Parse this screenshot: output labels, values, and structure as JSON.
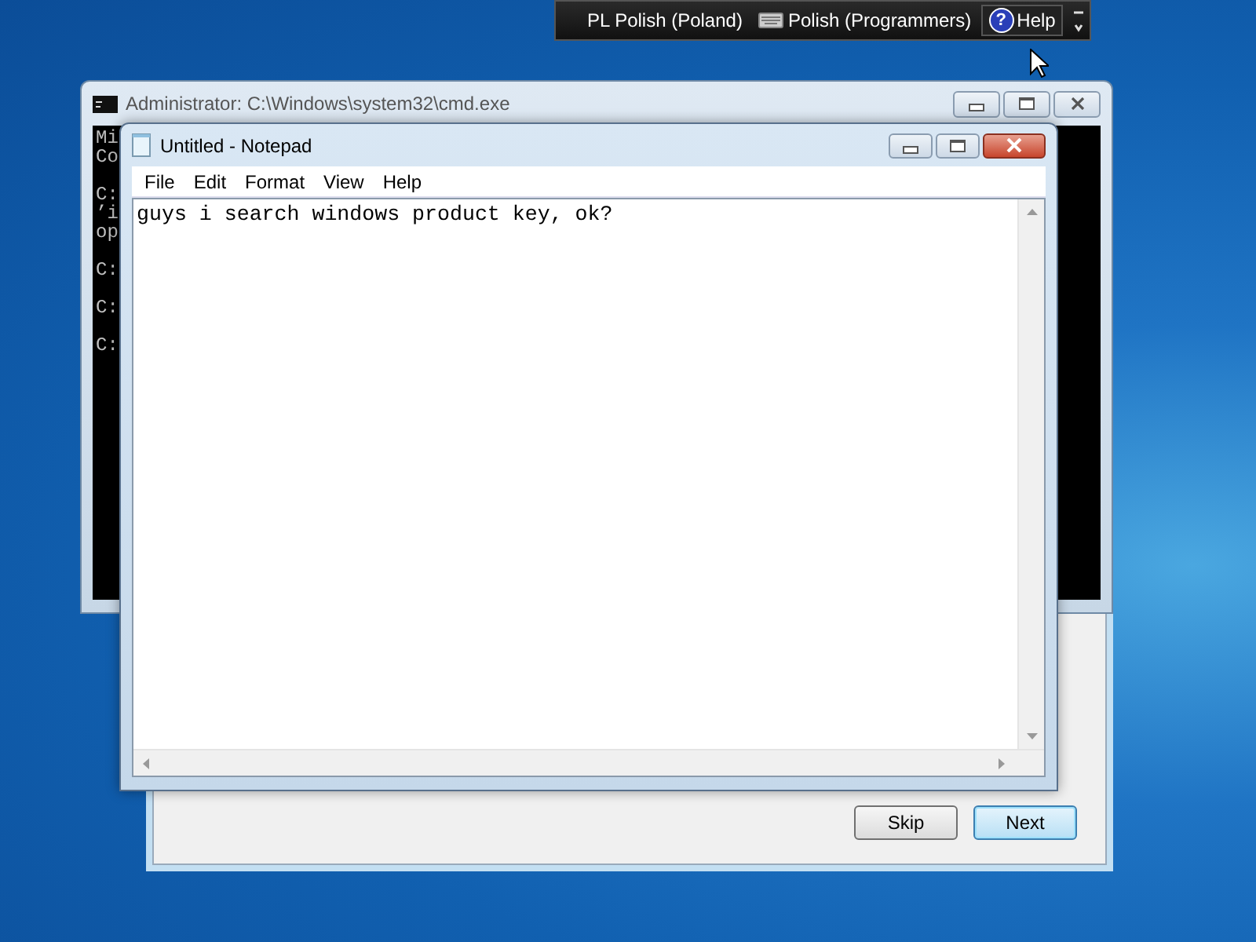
{
  "language_bar": {
    "language": "PL Polish (Poland)",
    "keyboard": "Polish (Programmers)",
    "help_icon": "?",
    "help": "Help"
  },
  "cmd_window": {
    "title": "Administrator: C:\\Windows\\system32\\cmd.exe",
    "blocks": [
      [
        "Mi",
        "Co"
      ],
      [
        "C:",
        "’i",
        "op"
      ],
      [
        "C:"
      ],
      [
        "C:"
      ],
      [
        "C:"
      ]
    ]
  },
  "notepad": {
    "title": "Untitled - Notepad",
    "menu": [
      "File",
      "Edit",
      "Format",
      "View",
      "Help"
    ],
    "text": "guys i search windows product key, ok?"
  },
  "setup_dialog": {
    "buttons": [
      {
        "label": "Skip",
        "default": false
      },
      {
        "label": "Next",
        "default": true
      }
    ]
  }
}
